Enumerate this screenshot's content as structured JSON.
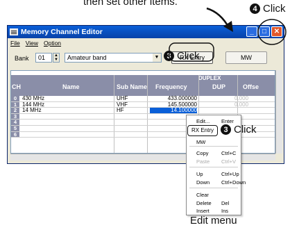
{
  "annotations": {
    "top_note": "then set other items.",
    "step4_label": "Click",
    "step4_num": "4",
    "step3_num": "3",
    "step3_top_label": "Click",
    "step3_menu_label": "Click",
    "caption": "Edit menu"
  },
  "window": {
    "title": "Memory Channel Editor",
    "menu": [
      "File",
      "View",
      "Option"
    ],
    "bank_label": "Bank",
    "bank_value": "01",
    "bank_name": "Amateur band",
    "rx_button": "RX Entry",
    "mw_button": "MW"
  },
  "grid": {
    "group_header": "DUPLEX",
    "columns": [
      "CH",
      "Name",
      "Sub Name",
      "Frequency",
      "DUP",
      "Offse"
    ],
    "rows": [
      {
        "ch": "0",
        "name": "430 MHz",
        "sub": "UHF",
        "freq": "433.000000",
        "off": "0.000"
      },
      {
        "ch": "1",
        "name": "144 MHz",
        "sub": "VHF",
        "freq": "145.500000",
        "off": "0.000"
      },
      {
        "ch": "2",
        "name": "14 MHz",
        "sub": "HF",
        "freq": "14.100000",
        "off": ""
      },
      {
        "ch": "3",
        "name": "",
        "sub": "",
        "freq": "",
        "off": ""
      },
      {
        "ch": "4",
        "name": "",
        "sub": "",
        "freq": "",
        "off": ""
      },
      {
        "ch": "5",
        "name": "",
        "sub": "",
        "freq": "",
        "off": ""
      },
      {
        "ch": "6",
        "name": "",
        "sub": "",
        "freq": "",
        "off": ""
      }
    ]
  },
  "context_menu": {
    "items": [
      {
        "label": "Edit...",
        "key": "Enter"
      },
      {
        "label": "RX Entry",
        "key": ""
      },
      {
        "label": "MW",
        "key": ""
      },
      {
        "label": "Copy",
        "key": "Ctrl+C"
      },
      {
        "label": "Paste",
        "key": "Ctrl+V"
      },
      {
        "label": "Up",
        "key": "Ctrl+Up"
      },
      {
        "label": "Down",
        "key": "Ctrl+Down"
      },
      {
        "label": "Clear",
        "key": ""
      },
      {
        "label": "Delete",
        "key": "Del"
      },
      {
        "label": "Insert",
        "key": "Ins"
      }
    ]
  }
}
